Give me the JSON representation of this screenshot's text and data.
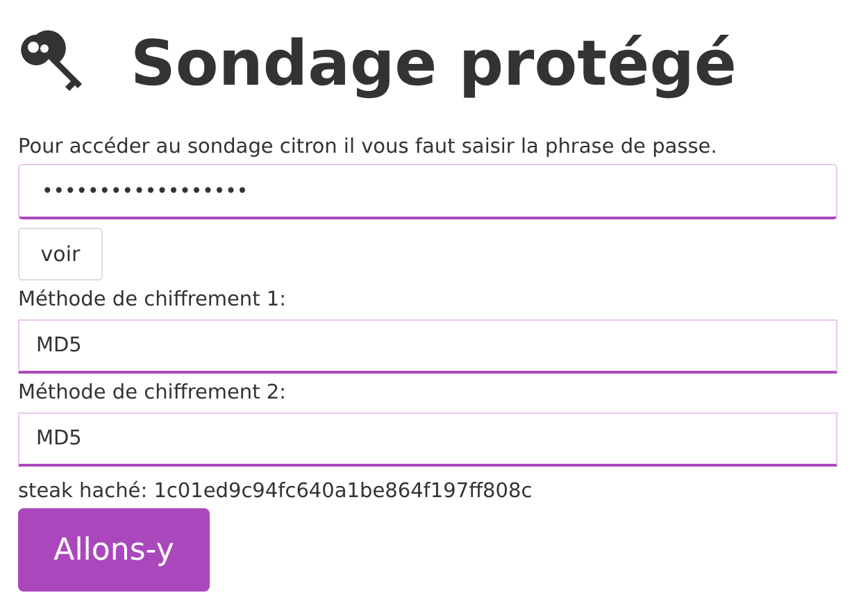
{
  "title": "Sondage protégé",
  "instructions": "Pour accéder au sondage citron il vous faut saisir la phrase de passe.",
  "passphrase": {
    "value": "••••••••••••••••••"
  },
  "show_button": "voir",
  "methods": [
    {
      "label": "Méthode de chiffrement 1:",
      "value": "MD5"
    },
    {
      "label": "Méthode de chiffrement 2:",
      "value": "MD5"
    }
  ],
  "hash": "steak haché: 1c01ed9c94fc640a1be864f197ff808c",
  "submit_button": "Allons-y"
}
